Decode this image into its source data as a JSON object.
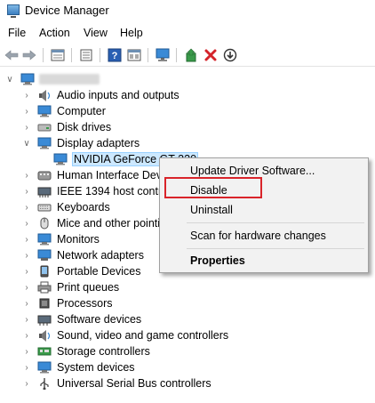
{
  "window": {
    "title": "Device Manager"
  },
  "menu": [
    "File",
    "Action",
    "View",
    "Help"
  ],
  "toolbar": {
    "icons": [
      "back-arrow-icon",
      "forward-arrow-icon",
      "properties-icon",
      "show-hide-console-icon",
      "help-icon",
      "action-pane-icon",
      "monitor-scan-icon",
      "update-driver-icon",
      "uninstall-icon",
      "download-icon"
    ]
  },
  "tree": {
    "categories": [
      "Audio inputs and outputs",
      "Computer",
      "Disk drives",
      "Display adapters",
      "NVIDIA GeForce GT 220",
      "Human Interface Devi",
      "IEEE 1394 host control",
      "Keyboards",
      "Mice and other pointi",
      "Monitors",
      "Network adapters",
      "Portable Devices",
      "Print queues",
      "Processors",
      "Software devices",
      "Sound, video and game controllers",
      "Storage controllers",
      "System devices",
      "Universal Serial Bus controllers"
    ]
  },
  "context_menu": {
    "update": "Update Driver Software...",
    "disable": "Disable",
    "uninstall": "Uninstall",
    "scan": "Scan for hardware changes",
    "properties": "Properties"
  },
  "colors": {
    "highlight_box": "#d9242a",
    "selection": "#cce8ff",
    "accent": "#1f6fbf"
  }
}
